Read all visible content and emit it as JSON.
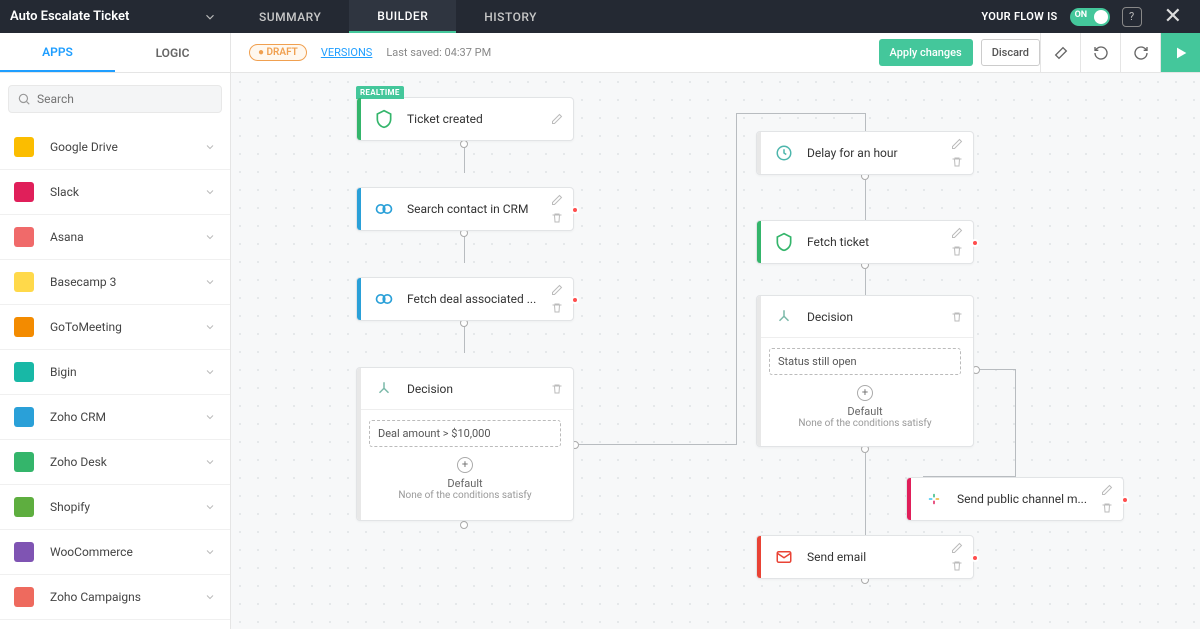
{
  "header": {
    "title": "Auto Escalate Ticket",
    "tabs": [
      "SUMMARY",
      "BUILDER",
      "HISTORY"
    ],
    "active_tab": 1,
    "flow_status_label": "YOUR FLOW IS",
    "toggle_text": "ON"
  },
  "subbar": {
    "left_tabs": [
      "APPS",
      "LOGIC"
    ],
    "active_left_tab": 0,
    "draft_label": "DRAFT",
    "versions_label": "VERSIONS",
    "last_saved": "Last saved: 04:37 PM",
    "apply_label": "Apply changes",
    "discard_label": "Discard"
  },
  "search": {
    "placeholder": "Search"
  },
  "apps": [
    {
      "label": "Google Drive",
      "color": "#fbbd00"
    },
    {
      "label": "Slack",
      "color": "#e01f5a"
    },
    {
      "label": "Asana",
      "color": "#f06a6a"
    },
    {
      "label": "Basecamp 3",
      "color": "#ffd94a"
    },
    {
      "label": "GoToMeeting",
      "color": "#f38b00"
    },
    {
      "label": "Bigin",
      "color": "#18b8a6"
    },
    {
      "label": "Zoho CRM",
      "color": "#2aa0d8"
    },
    {
      "label": "Zoho Desk",
      "color": "#34b56b"
    },
    {
      "label": "Shopify",
      "color": "#5eae3f"
    },
    {
      "label": "WooCommerce",
      "color": "#7f54b3"
    },
    {
      "label": "Zoho Campaigns",
      "color": "#ee6a5e"
    }
  ],
  "nodes": {
    "n1": {
      "title": "Ticket created",
      "accent": "#34b56b",
      "tag": "REALTIME"
    },
    "n2": {
      "title": "Search contact in CRM",
      "accent": "#2aa0d8"
    },
    "n3": {
      "title": "Fetch deal associated ...",
      "accent": "#2aa0d8"
    },
    "n4": {
      "title": "Decision",
      "accent": "#ffffff"
    },
    "branch1": {
      "label": "Deal amount > $10,000"
    },
    "default1": {
      "title": "Default",
      "sub": "None of the conditions satisfy"
    },
    "n5": {
      "title": "Delay for an hour",
      "accent": "#eeeeee"
    },
    "n6": {
      "title": "Fetch ticket",
      "accent": "#34b56b"
    },
    "n7": {
      "title": "Decision",
      "accent": "#ffffff"
    },
    "branch2": {
      "label": "Status still open"
    },
    "default2": {
      "title": "Default",
      "sub": "None of the conditions satisfy"
    },
    "n8": {
      "title": "Send public channel m...",
      "accent": "#e01f5a"
    },
    "n9": {
      "title": "Send email",
      "accent": "#e94335"
    }
  }
}
